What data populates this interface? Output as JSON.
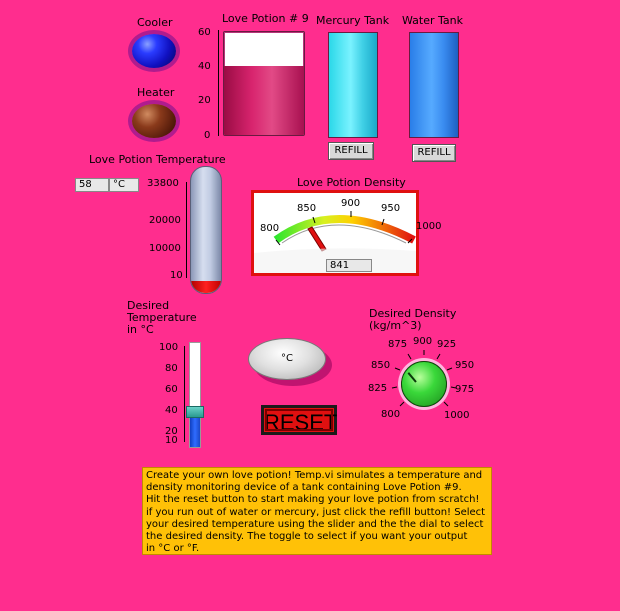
{
  "indicators": {
    "cooler_label": "Cooler",
    "heater_label": "Heater"
  },
  "love_potion_tank": {
    "title": "Love Potion # 9",
    "scale": [
      "60",
      "40",
      "20",
      "0"
    ],
    "level": 40,
    "max": 60
  },
  "mercury_tank": {
    "title": "Mercury Tank",
    "refill_label": "REFILL"
  },
  "water_tank": {
    "title": "Water Tank",
    "refill_label": "REFILL"
  },
  "temperature": {
    "title": "Love Potion Temperature",
    "value": "58",
    "unit": "°C",
    "scale": [
      "33800",
      "20000",
      "10000",
      "10"
    ],
    "level_fraction": 0.02
  },
  "density": {
    "title": "Love Potion Density",
    "scale": [
      "800",
      "850",
      "900",
      "950",
      "1000"
    ],
    "value": "841"
  },
  "desired_temperature": {
    "title_line1": "Desired",
    "title_line2": "Temperature",
    "title_line3": "in °C",
    "scale": [
      "100",
      "80",
      "60",
      "40",
      "20",
      "10"
    ],
    "level_fraction": 0.34
  },
  "toggle": {
    "label": "°C"
  },
  "reset": {
    "label": "RESET"
  },
  "desired_density": {
    "title_line1": "Desired Density",
    "title_line2": "(kg/m^3)",
    "scale": [
      "800",
      "825",
      "850",
      "875",
      "900",
      "925",
      "950",
      "975",
      "1000"
    ]
  },
  "description": "Create your own love potion!  Temp.vi simulates a temperature and\ndensity monitoring device of a tank containing Love Potion #9.\nHit the reset button to start making your love potion from scratch!\nif you run out of water or mercury, just click the refill button! Select\n your desired temperature using the slider and the the dial to select\nthe desired density. The toggle to select if you want your output\n in °C or °F.",
  "colors": {
    "background": "#ff2d8e",
    "description_bg": "#ffc107",
    "gauge_border": "#e01010",
    "reset_bg": "#e01010"
  }
}
